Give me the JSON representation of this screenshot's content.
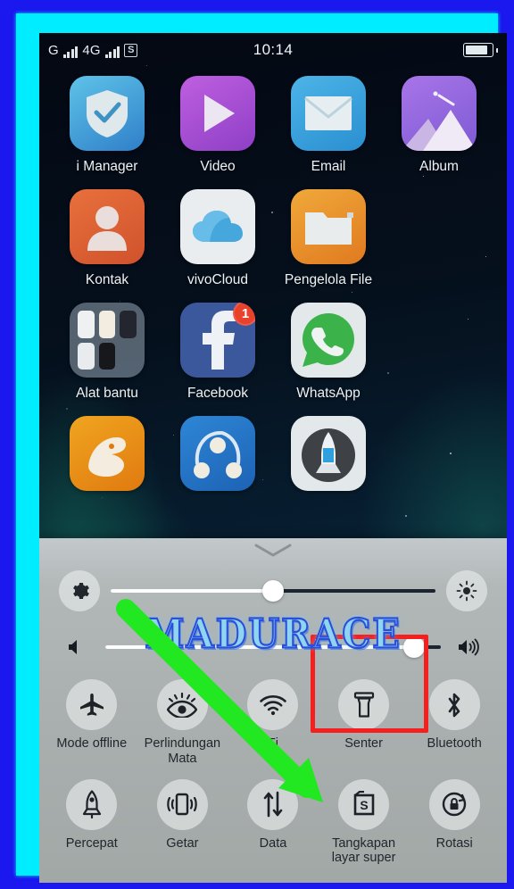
{
  "frame": {
    "outer_color": "#1a17ef",
    "inner_color": "#00ecff"
  },
  "status_bar": {
    "network_1": "G",
    "network_2": "4G",
    "screenshot_indicator": "S",
    "clock": "10:14",
    "battery_icon": "battery-icon"
  },
  "home_screen": {
    "apps": [
      {
        "label": "i Manager",
        "icon": "shield-check-icon"
      },
      {
        "label": "Video",
        "icon": "play-icon"
      },
      {
        "label": "Email",
        "icon": "envelope-icon"
      },
      {
        "label": "Album",
        "icon": "mountain-photo-icon"
      },
      {
        "label": "Kontak",
        "icon": "person-icon"
      },
      {
        "label": "vivoCloud",
        "icon": "cloud-icon"
      },
      {
        "label": "Pengelola File",
        "icon": "folder-icon"
      },
      {
        "label": "Alat bantu",
        "icon": "folder-group-icon"
      },
      {
        "label": "Facebook",
        "icon": "facebook-icon",
        "badge": "1"
      },
      {
        "label": "WhatsApp",
        "icon": "whatsapp-icon"
      },
      {
        "label": "",
        "icon": "uc-browser-icon"
      },
      {
        "label": "",
        "icon": "shareit-icon"
      },
      {
        "label": "",
        "icon": "rocket-clean-icon"
      }
    ]
  },
  "control_panel": {
    "handle": "chevron-down-handle",
    "brightness": {
      "left_icon": "gear-icon",
      "right_icon": "brightness-sun-icon",
      "value_percent": 50
    },
    "volume": {
      "left_icon": "volume-mute-icon",
      "right_icon": "volume-up-icon",
      "value_percent": 92
    },
    "toggles": [
      {
        "label": "Mode offline",
        "icon": "airplane-icon"
      },
      {
        "label": "Perlindungan Mata",
        "icon": "eye-icon"
      },
      {
        "label": "Fi",
        "icon": "wifi-icon"
      },
      {
        "label": "Senter",
        "icon": "flashlight-icon"
      },
      {
        "label": "Bluetooth",
        "icon": "bluetooth-icon"
      },
      {
        "label": "Percepat",
        "icon": "rocket-icon"
      },
      {
        "label": "Getar",
        "icon": "vibrate-icon"
      },
      {
        "label": "Data",
        "icon": "data-arrows-icon"
      },
      {
        "label": "Tangkapan layar super",
        "icon": "super-screenshot-icon",
        "highlighted": true
      },
      {
        "label": "Rotasi",
        "icon": "rotation-lock-icon"
      }
    ]
  },
  "annotations": {
    "watermark_text": "MADURACE",
    "watermark_color": "#8fd4f0",
    "arrow_color": "#22e822",
    "highlight_box_color": "#f42020"
  }
}
